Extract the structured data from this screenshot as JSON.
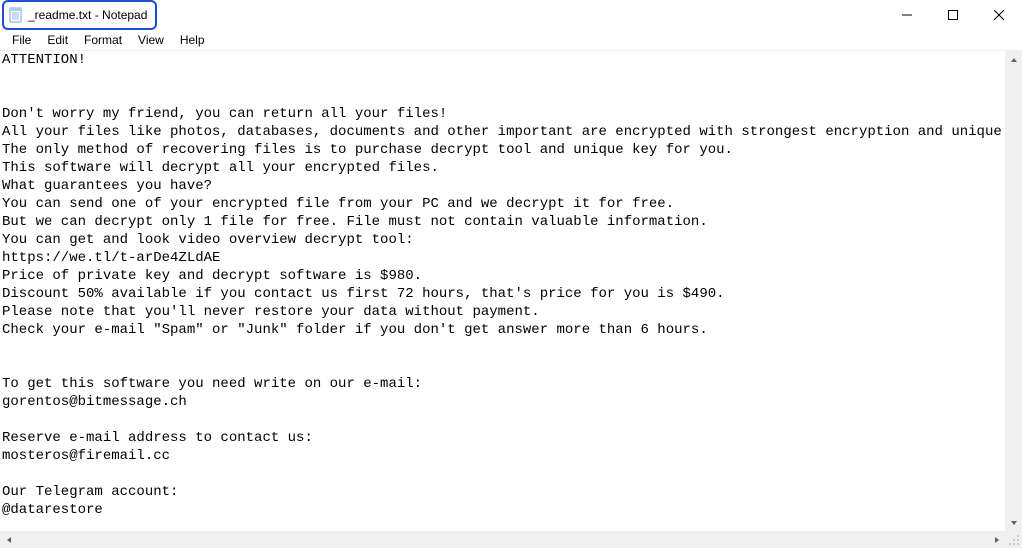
{
  "window": {
    "title": "_readme.txt - Notepad"
  },
  "menu": {
    "file": "File",
    "edit": "Edit",
    "format": "Format",
    "view": "View",
    "help": "Help"
  },
  "document": {
    "text": "ATTENTION!\n\n\nDon't worry my friend, you can return all your files!\nAll your files like photos, databases, documents and other important are encrypted with strongest encryption and unique key.\nThe only method of recovering files is to purchase decrypt tool and unique key for you.\nThis software will decrypt all your encrypted files.\nWhat guarantees you have?\nYou can send one of your encrypted file from your PC and we decrypt it for free.\nBut we can decrypt only 1 file for free. File must not contain valuable information.\nYou can get and look video overview decrypt tool:\nhttps://we.tl/t-arDe4ZLdAE\nPrice of private key and decrypt software is $980.\nDiscount 50% available if you contact us first 72 hours, that's price for you is $490.\nPlease note that you'll never restore your data without payment.\nCheck your e-mail \"Spam\" or \"Junk\" folder if you don't get answer more than 6 hours.\n\n\nTo get this software you need write on our e-mail:\ngorentos@bitmessage.ch\n\nReserve e-mail address to contact us:\nmosteros@firemail.cc\n\nOur Telegram account:\n@datarestore"
  }
}
